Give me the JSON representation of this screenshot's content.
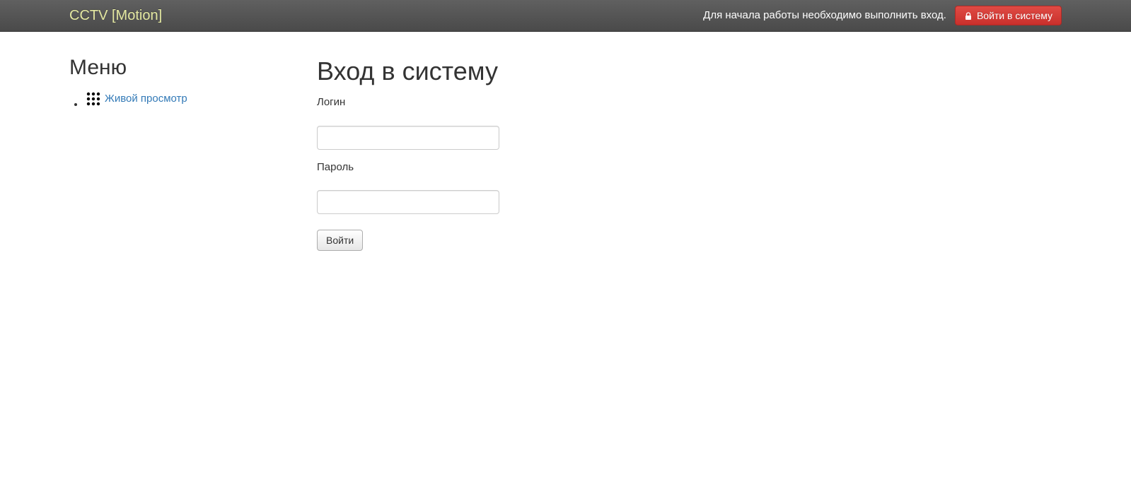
{
  "header": {
    "brand": "CCTV [Motion]",
    "message": "Для начала работы необходимо выполнить вход.",
    "login_button": "Войти в систему"
  },
  "sidebar": {
    "title": "Меню",
    "items": [
      {
        "label": "Живой просмотр"
      }
    ]
  },
  "main": {
    "title": "Вход в систему",
    "login_label": "Логин",
    "login_value": "",
    "password_label": "Пароль",
    "password_value": "",
    "submit_label": "Войти"
  }
}
